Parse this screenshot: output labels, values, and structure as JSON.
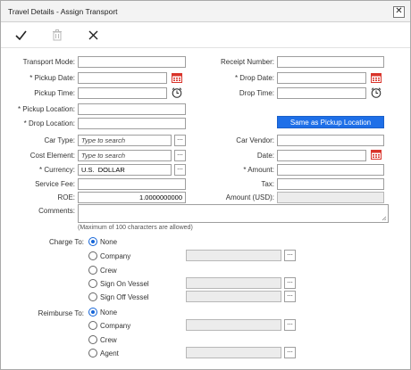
{
  "dialog": {
    "title": "Travel Details - Assign Transport",
    "close_glyph": "✕"
  },
  "toolbar": {
    "save_icon": "checkmark-icon",
    "delete_icon": "trash-icon",
    "cancel_icon": "x-icon"
  },
  "form": {
    "transport_mode_label": "Transport Mode:",
    "receipt_number_label": "Receipt Number:",
    "pickup_date_label": "* Pickup Date:",
    "drop_date_label": "* Drop Date:",
    "pickup_time_label": "Pickup Time:",
    "drop_time_label": "Drop Time:",
    "pickup_location_label": "* Pickup Location:",
    "drop_location_label": "* Drop Location:",
    "same_as_pickup_label": "Same as Pickup Location",
    "car_type_label": "Car Type:",
    "car_type_placeholder": "Type to search",
    "car_vendor_label": "Car Vendor:",
    "cost_element_label": "Cost Element:",
    "cost_element_placeholder": "Type to search",
    "date_label": "Date:",
    "currency_label": "* Currency:",
    "currency_value": "U.S.  DOLLAR",
    "amount_label": "* Amount:",
    "service_fee_label": "Service Fee:",
    "tax_label": "Tax:",
    "roe_label": "ROE:",
    "roe_value": "1.0000000000",
    "amount_usd_label": "Amount (USD):",
    "comments_label": "Comments:",
    "comments_hint": "(Maximum of 100 characters are allowed)",
    "dots_label": "..."
  },
  "charge_to": {
    "label": "Charge To:",
    "options": [
      "None",
      "Company",
      "Crew",
      "Sign On Vessel",
      "Sign Off Vessel"
    ],
    "selected": "None"
  },
  "reimburse_to": {
    "label": "Reimburse To:",
    "options": [
      "None",
      "Company",
      "Crew",
      "Agent"
    ],
    "selected": "None"
  },
  "colors": {
    "accent": "#1e6fe8",
    "calendar_red": "#d9342b"
  }
}
